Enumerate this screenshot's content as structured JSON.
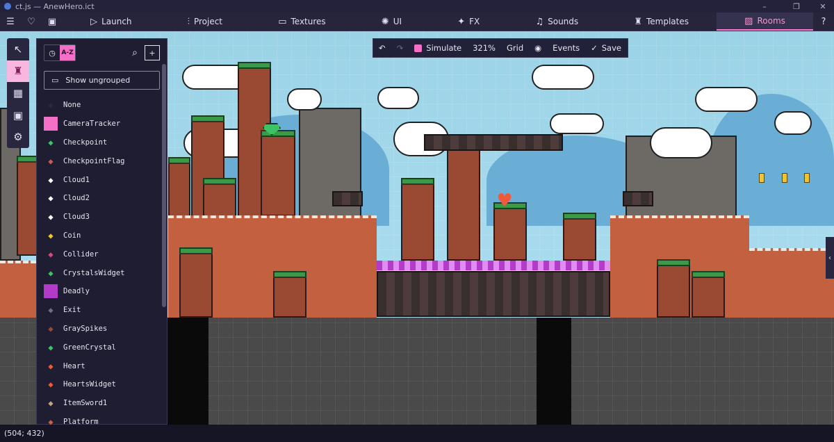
{
  "window": {
    "title": "ct.js — AnewHero.ict",
    "controls": [
      "–",
      "❐",
      "✕"
    ]
  },
  "nav": {
    "menu_icon": "hamburger-icon",
    "tabs": [
      {
        "id": "launch",
        "label": "Launch",
        "icon": "play-icon"
      },
      {
        "id": "project",
        "label": "Project",
        "icon": "sliders-icon"
      },
      {
        "id": "textures",
        "label": "Textures",
        "icon": "image-icon"
      },
      {
        "id": "ui",
        "label": "UI",
        "icon": "sparkle-icon"
      },
      {
        "id": "fx",
        "label": "FX",
        "icon": "sparkle-icon"
      },
      {
        "id": "sounds",
        "label": "Sounds",
        "icon": "headphones-icon"
      },
      {
        "id": "templates",
        "label": "Templates",
        "icon": "template-icon"
      },
      {
        "id": "rooms",
        "label": "Rooms",
        "icon": "rooms-icon",
        "active": true
      }
    ]
  },
  "room_toolbar": {
    "simulate": "Simulate",
    "zoom": "321%",
    "grid": "Grid",
    "events": "Events",
    "save": "Save"
  },
  "library": {
    "show_ungrouped": "Show ungrouped",
    "sort_label": "A-Z",
    "items": [
      {
        "name": "None",
        "color": "#2a2940"
      },
      {
        "name": "CameraTracker",
        "color": "#f36fc8"
      },
      {
        "name": "Checkpoint",
        "color": "#3ac464"
      },
      {
        "name": "CheckpointFlag",
        "color": "#c45a5a"
      },
      {
        "name": "Cloud1",
        "color": "#ffffff"
      },
      {
        "name": "Cloud2",
        "color": "#ffffff"
      },
      {
        "name": "Cloud3",
        "color": "#ffffff"
      },
      {
        "name": "Coin",
        "color": "#f3c52a"
      },
      {
        "name": "Collider",
        "color": "#d64a7a"
      },
      {
        "name": "CrystalsWidget",
        "color": "#3ac464"
      },
      {
        "name": "Deadly",
        "color": "#b43ac9"
      },
      {
        "name": "Exit",
        "color": "#6e6d88"
      },
      {
        "name": "GraySpikes",
        "color": "#9a4a33"
      },
      {
        "name": "GreenCrystal",
        "color": "#3ac464"
      },
      {
        "name": "Heart",
        "color": "#f05a3a"
      },
      {
        "name": "HeartsWidget",
        "color": "#f05a3a"
      },
      {
        "name": "ItemSword1",
        "color": "#c4a47a"
      },
      {
        "name": "Platform",
        "color": "#c2603f"
      }
    ]
  },
  "status": {
    "cursor": "(504; 432)"
  }
}
